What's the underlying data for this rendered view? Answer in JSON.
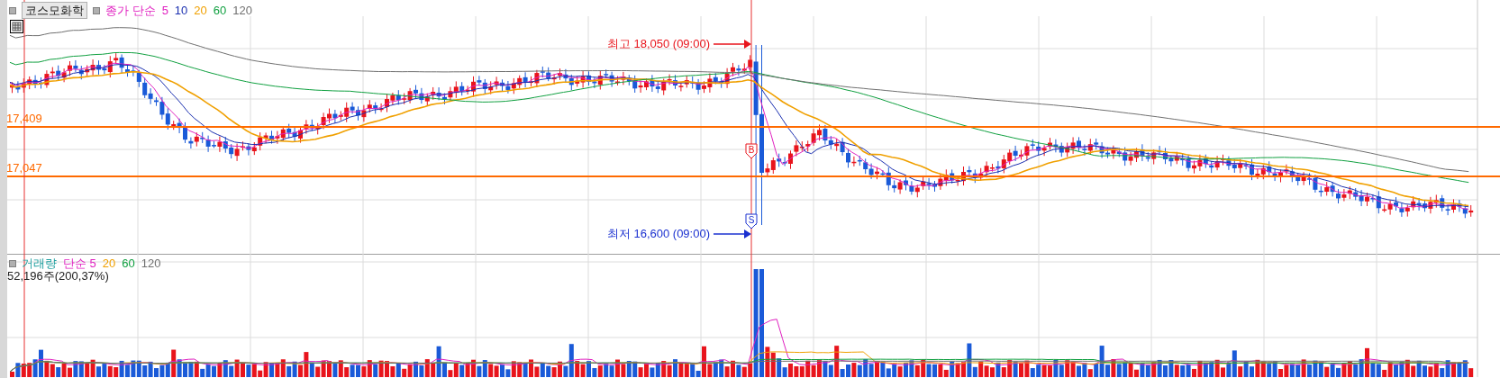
{
  "symbol": "코스모화학",
  "price_indicator": {
    "label": "종가 단순",
    "color": "#e020c0"
  },
  "price_periods": [
    {
      "text": "5",
      "color": "#e020c0"
    },
    {
      "text": "10",
      "color": "#1a2fb0"
    },
    {
      "text": "20",
      "color": "#f0a000"
    },
    {
      "text": "60",
      "color": "#10a040"
    },
    {
      "text": "120",
      "color": "#707070"
    }
  ],
  "levels": [
    {
      "text": "17,409"
    },
    {
      "text": "17,047"
    }
  ],
  "high_marker": {
    "text": "최고 18,050 (09:00)",
    "badge": "B"
  },
  "low_marker": {
    "text": "최저 16,600 (09:00)",
    "badge": "S"
  },
  "volume_indicator": {
    "label": "거래량",
    "color": "#20a0a0"
  },
  "volume_periods": [
    {
      "text": "단순 5",
      "color": "#e020c0"
    },
    {
      "text": "20",
      "color": "#f0a000"
    },
    {
      "text": "60",
      "color": "#10a040"
    },
    {
      "text": "120",
      "color": "#707070"
    }
  ],
  "volume_reading": "52,196주(200,37%)"
}
